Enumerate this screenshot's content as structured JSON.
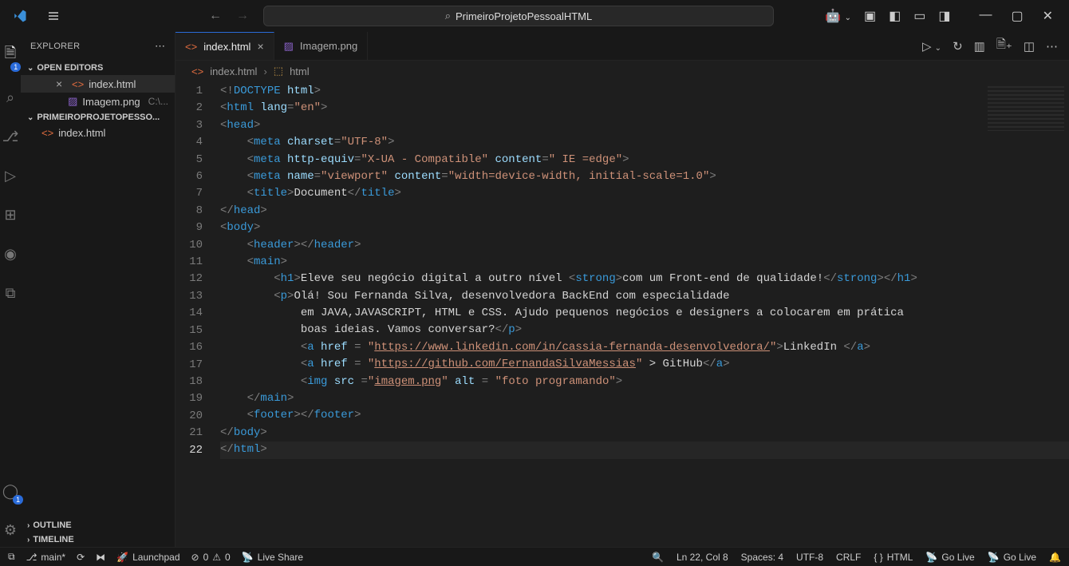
{
  "window": {
    "search_text": "PrimeiroProjetoPessoalHTML"
  },
  "sidebar": {
    "title": "EXPLORER",
    "open_editors_label": "OPEN EDITORS",
    "open_editors": [
      {
        "name": "index.html",
        "close": "×",
        "type": "html"
      },
      {
        "name": "Imagem.png",
        "path": "C:\\...",
        "type": "img"
      }
    ],
    "project_label": "PRIMEIROPROJETOPESSO...",
    "project_files": [
      {
        "name": "index.html",
        "type": "html"
      }
    ],
    "outline_label": "OUTLINE",
    "timeline_label": "TIMELINE"
  },
  "tabs": [
    {
      "name": "index.html",
      "active": true,
      "type": "html"
    },
    {
      "name": "Imagem.png",
      "active": false,
      "type": "img"
    }
  ],
  "breadcrumb": {
    "file": "index.html",
    "symbol": "html"
  },
  "code": {
    "lines": [
      {
        "n": 1,
        "html": "<span class='tk-punc'>&lt;!</span><span class='tk-doctype'>DOCTYPE</span> <span class='tk-attr'>html</span><span class='tk-punc'>&gt;</span>"
      },
      {
        "n": 2,
        "html": "<span class='tk-punc'>&lt;</span><span class='tk-tag'>html</span> <span class='tk-attr'>lang</span><span class='tk-punc'>=</span><span class='tk-str'>\"en\"</span><span class='tk-punc'>&gt;</span>"
      },
      {
        "n": 3,
        "html": "<span class='tk-punc'>&lt;</span><span class='tk-tag'>head</span><span class='tk-punc'>&gt;</span>"
      },
      {
        "n": 4,
        "html": "    <span class='tk-punc'>&lt;</span><span class='tk-tag'>meta</span> <span class='tk-attr'>charset</span><span class='tk-punc'>=</span><span class='tk-str'>\"UTF-8\"</span><span class='tk-punc'>&gt;</span>"
      },
      {
        "n": 5,
        "html": "    <span class='tk-punc'>&lt;</span><span class='tk-tag'>meta</span> <span class='tk-attr'>http-equiv</span><span class='tk-punc'>=</span><span class='tk-str'>\"X-UA - Compatible\"</span> <span class='tk-attr'>content</span><span class='tk-punc'>=</span><span class='tk-str'>\" IE =edge\"</span><span class='tk-punc'>&gt;</span>"
      },
      {
        "n": 6,
        "html": "    <span class='tk-punc'>&lt;</span><span class='tk-tag'>meta</span> <span class='tk-attr'>name</span><span class='tk-punc'>=</span><span class='tk-str'>\"viewport\"</span> <span class='tk-attr'>content</span><span class='tk-punc'>=</span><span class='tk-str'>\"width=device-width, initial-scale=1.0\"</span><span class='tk-punc'>&gt;</span>"
      },
      {
        "n": 7,
        "html": "    <span class='tk-punc'>&lt;</span><span class='tk-tag'>title</span><span class='tk-punc'>&gt;</span><span class='tk-text'>Document</span><span class='tk-punc'>&lt;/</span><span class='tk-tag'>title</span><span class='tk-punc'>&gt;</span>"
      },
      {
        "n": 8,
        "html": "<span class='tk-punc'>&lt;/</span><span class='tk-tag'>head</span><span class='tk-punc'>&gt;</span>"
      },
      {
        "n": 9,
        "html": "<span class='tk-punc'>&lt;</span><span class='tk-tag'>body</span><span class='tk-punc'>&gt;</span>"
      },
      {
        "n": 10,
        "html": "    <span class='tk-punc'>&lt;</span><span class='tk-tag'>header</span><span class='tk-punc'>&gt;&lt;/</span><span class='tk-tag'>header</span><span class='tk-punc'>&gt;</span>"
      },
      {
        "n": 11,
        "html": "    <span class='tk-punc'>&lt;</span><span class='tk-tag'>main</span><span class='tk-punc'>&gt;</span>"
      },
      {
        "n": 12,
        "html": "        <span class='tk-punc'>&lt;</span><span class='tk-tag'>h1</span><span class='tk-punc'>&gt;</span><span class='tk-text'>Eleve seu negócio digital a outro nível </span><span class='tk-punc'>&lt;</span><span class='tk-tag'>strong</span><span class='tk-punc'>&gt;</span><span class='tk-text'>com um Front-end de qualidade!</span><span class='tk-punc'>&lt;/</span><span class='tk-tag'>strong</span><span class='tk-punc'>&gt;&lt;/</span><span class='tk-tag'>h1</span><span class='tk-punc'>&gt;</span>"
      },
      {
        "n": 13,
        "html": "        <span class='tk-punc'>&lt;</span><span class='tk-tag'>p</span><span class='tk-punc'>&gt;</span><span class='tk-text'>Olá! Sou Fernanda Silva, desenvolvedora BackEnd com especialidade</span>"
      },
      {
        "n": 14,
        "html": "            <span class='tk-text'>em JAVA,JAVASCRIPT, HTML e CSS. Ajudo pequenos negócios e designers a colocarem em prática</span>"
      },
      {
        "n": 15,
        "html": "            <span class='tk-text'>boas ideias. Vamos conversar?</span><span class='tk-punc'>&lt;/</span><span class='tk-tag'>p</span><span class='tk-punc'>&gt;</span>"
      },
      {
        "n": 16,
        "html": "            <span class='tk-punc'>&lt;</span><span class='tk-tag'>a</span> <span class='tk-attr'>href</span> <span class='tk-punc'>=</span> <span class='tk-str'>\"</span><span class='tk-link'>https://www.linkedin.com/in/cassia-fernanda-desenvolvedora/</span><span class='tk-str'>\"</span><span class='tk-punc'>&gt;</span><span class='tk-text'>LinkedIn </span><span class='tk-punc'>&lt;/</span><span class='tk-tag'>a</span><span class='tk-punc'>&gt;</span>"
      },
      {
        "n": 17,
        "html": "            <span class='tk-punc'>&lt;</span><span class='tk-tag'>a</span> <span class='tk-attr'>href</span> <span class='tk-punc'>=</span> <span class='tk-str'>\"</span><span class='tk-link'>https://github.com/FernandaSilvaMessias</span><span class='tk-str'>\"</span><span class='tk-text'> &gt; GitHub</span><span class='tk-punc'>&lt;/</span><span class='tk-tag'>a</span><span class='tk-punc'>&gt;</span>"
      },
      {
        "n": 18,
        "html": "            <span class='tk-punc'>&lt;</span><span class='tk-tag'>img</span> <span class='tk-attr'>src</span> <span class='tk-punc'>=</span><span class='tk-str'>\"</span><span class='tk-link'>imagem.png</span><span class='tk-str'>\"</span> <span class='tk-attr'>alt</span> <span class='tk-punc'>=</span> <span class='tk-str'>\"foto programando\"</span><span class='tk-punc'>&gt;</span>"
      },
      {
        "n": 19,
        "html": "    <span class='tk-punc'>&lt;/</span><span class='tk-tag'>main</span><span class='tk-punc'>&gt;</span>"
      },
      {
        "n": 20,
        "html": "    <span class='tk-punc'>&lt;</span><span class='tk-tag'>footer</span><span class='tk-punc'>&gt;&lt;/</span><span class='tk-tag'>footer</span><span class='tk-punc'>&gt;</span>"
      },
      {
        "n": 21,
        "html": "<span class='tk-punc'>&lt;/</span><span class='tk-tag'>body</span><span class='tk-punc'>&gt;</span>"
      },
      {
        "n": 22,
        "html": "<span class='tk-punc'>&lt;/</span><span class='tk-tag'>html</span><span class='tk-punc'>&gt;</span>",
        "current": true
      }
    ]
  },
  "status": {
    "branch": "main*",
    "launchpad": "Launchpad",
    "errors": "0",
    "warnings": "0",
    "liveshare": "Live Share",
    "cursor": "Ln 22, Col 8",
    "spaces": "Spaces: 4",
    "encoding": "UTF-8",
    "eol": "CRLF",
    "lang": "HTML",
    "golive1": "Go Live",
    "golive2": "Go Live"
  }
}
